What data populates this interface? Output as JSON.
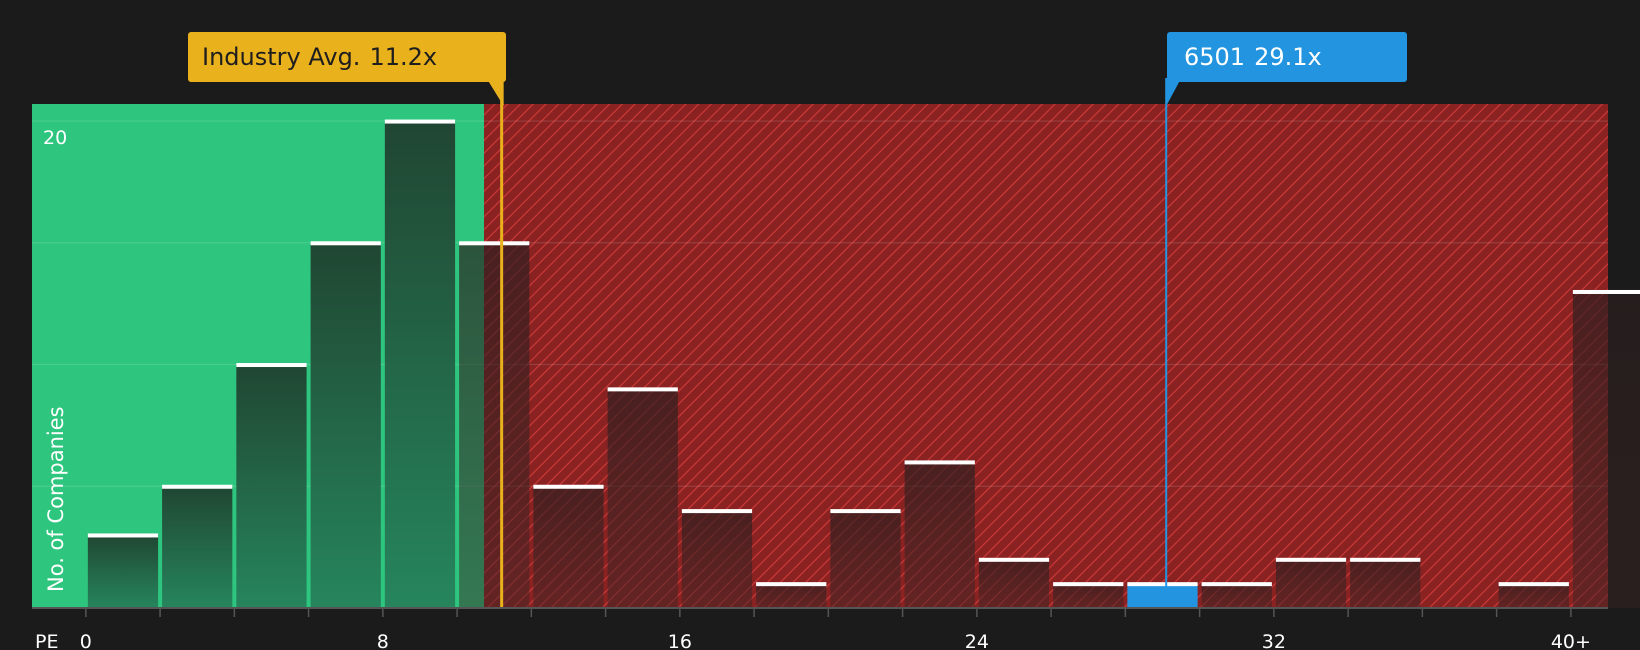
{
  "chart_data": {
    "type": "bar",
    "title": "",
    "xlabel": "PE",
    "ylabel": "No. of Companies",
    "x_ticks": [
      "0",
      "8",
      "16",
      "24",
      "32",
      "40+"
    ],
    "x_tick_values": [
      0,
      8,
      16,
      24,
      32,
      40
    ],
    "y_ticks": [
      "20"
    ],
    "y_tick_values": [
      20
    ],
    "xlim": [
      -1.45,
      41.0
    ],
    "ylim": [
      0,
      20.7
    ],
    "bin_width": 2,
    "bins": [
      {
        "x": 0,
        "value": 3
      },
      {
        "x": 2,
        "value": 5
      },
      {
        "x": 4,
        "value": 10
      },
      {
        "x": 6,
        "value": 15
      },
      {
        "x": 8,
        "value": 20
      },
      {
        "x": 10,
        "value": 15
      },
      {
        "x": 12,
        "value": 5
      },
      {
        "x": 14,
        "value": 9
      },
      {
        "x": 16,
        "value": 4
      },
      {
        "x": 18,
        "value": 1
      },
      {
        "x": 20,
        "value": 4
      },
      {
        "x": 22,
        "value": 6
      },
      {
        "x": 24,
        "value": 2
      },
      {
        "x": 26,
        "value": 1
      },
      {
        "x": 28,
        "value": 1
      },
      {
        "x": 30,
        "value": 1
      },
      {
        "x": 32,
        "value": 2
      },
      {
        "x": 34,
        "value": 2
      },
      {
        "x": 36,
        "value": 0
      },
      {
        "x": 38,
        "value": 1
      },
      {
        "x": 40,
        "value": 13
      }
    ],
    "highlight_bin_x": 28,
    "industry_avg": {
      "label": "Industry Avg.",
      "value": 11.2,
      "display": "11.2x"
    },
    "company": {
      "ticker": "6501",
      "value": 29.1,
      "display": "29.1x"
    },
    "gridlines": true,
    "colors": {
      "background": "#1b1b1b",
      "undervalued_zone": "#2ec67e",
      "overvalued_zone": "#8a2222",
      "hatch": "#d23a3a",
      "bar_fill_top": "#1f3b2c",
      "bar_fill_bottom": "#25805a",
      "bar_cap": "#ffffff",
      "industry_accent": "#e9b11c",
      "company_accent": "#2394e0",
      "axis_text": "#ffffff"
    }
  }
}
